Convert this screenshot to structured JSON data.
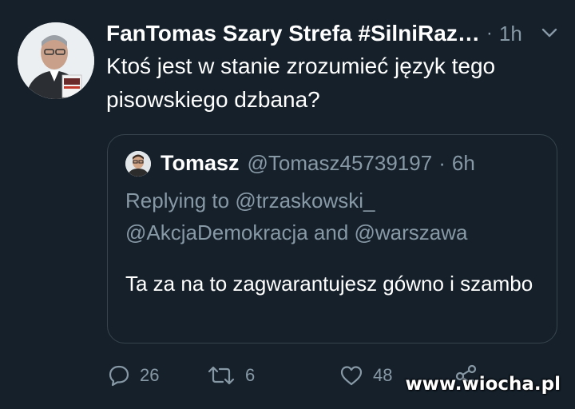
{
  "tweet": {
    "author_name": "FanTomas Szary Strefa #SilniRaz…",
    "separator": "·",
    "time": "1h",
    "text": "Ktoś jest w stanie zrozumieć język tego pisowskiego dzbana?",
    "avatar_icon": "profile-photo"
  },
  "quoted": {
    "name": "Tomasz",
    "handle": "@Tomasz45739197",
    "separator": "·",
    "time": "6h",
    "replying_prefix": "Replying to ",
    "replying_1": "@trzaskowski_",
    "replying_2": "@AkcjaDemokracja",
    "replying_and": " and ",
    "replying_3": "@warszawa",
    "text": "Ta za na to zagwarantujesz gówno i szambo"
  },
  "actions": {
    "reply_count": "26",
    "retweet_count": "6",
    "like_count": "48"
  },
  "watermark": "www.wiocha.pl",
  "colors": {
    "background": "#15202b",
    "secondary_text": "#8899a6",
    "border": "#38444d"
  }
}
